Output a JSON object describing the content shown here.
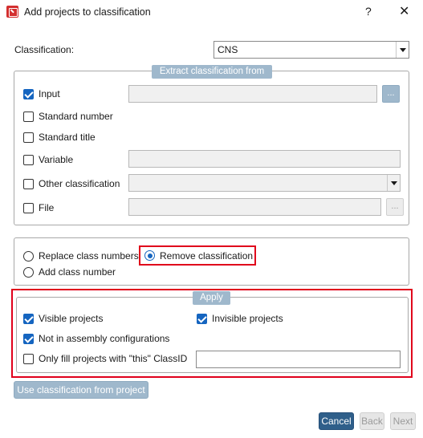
{
  "window": {
    "title": "Add projects to classification",
    "help": "?",
    "close": "✕"
  },
  "classification": {
    "label": "Classification:",
    "value": "CNS"
  },
  "extract": {
    "title": "Extract classification from",
    "input": {
      "label": "Input",
      "checked": true,
      "value": "",
      "browse": "..."
    },
    "standard_number": {
      "label": "Standard number",
      "checked": false
    },
    "standard_title": {
      "label": "Standard title",
      "checked": false
    },
    "variable": {
      "label": "Variable",
      "checked": false,
      "value": ""
    },
    "other_classification": {
      "label": "Other classification",
      "checked": false,
      "value": ""
    },
    "file": {
      "label": "File",
      "checked": false,
      "value": "",
      "browse": "..."
    }
  },
  "mode": {
    "replace": {
      "label": "Replace class numbers",
      "selected": false
    },
    "remove": {
      "label": "Remove classification",
      "selected": true
    },
    "add": {
      "label": "Add class number",
      "selected": false
    }
  },
  "apply": {
    "title": "Apply",
    "visible_projects": {
      "label": "Visible projects",
      "checked": true
    },
    "invisible_projects": {
      "label": "Invisible projects",
      "checked": true
    },
    "not_in_assembly": {
      "label": "Not in assembly configurations",
      "checked": true
    },
    "only_fill": {
      "label": "Only fill projects with \"this\" ClassID",
      "checked": false,
      "value": ""
    }
  },
  "buttons": {
    "use_classification": "Use classification from project",
    "cancel": "Cancel",
    "back": "Back",
    "next": "Next"
  },
  "colors": {
    "accent": "#1565c0",
    "highlight": "#e0001b",
    "legend": "#9fb8cc",
    "primary_button": "#2f5f8a"
  }
}
